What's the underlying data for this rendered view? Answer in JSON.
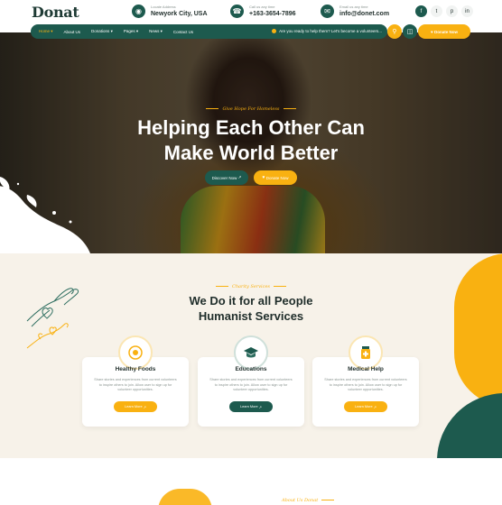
{
  "brand": {
    "name": "Donat"
  },
  "header": {
    "address": {
      "label": "Locate Address",
      "value": "Newyork City, USA"
    },
    "phone": {
      "label": "Call us any time",
      "value": "+163-3654-7896"
    },
    "email": {
      "label": "Email us any time",
      "value": "info@donet.com"
    },
    "social": [
      "f",
      "t",
      "p",
      "in"
    ]
  },
  "nav": {
    "items": [
      "Home",
      "About Us",
      "Donations",
      "Pages",
      "News",
      "Contact Us"
    ],
    "ticker": "Are you ready to help them? Let's become a volunteers...",
    "donate_label": "Donate Now"
  },
  "hero": {
    "kicker": "Give Hope For Homeless",
    "title_line1": "Helping Each Other Can",
    "title_line2": "Make World Better",
    "discover_label": "Discover Now",
    "donate_label": "Donate Now"
  },
  "services": {
    "kicker": "Charity Services",
    "title_line1": "We Do it for all People",
    "title_line2": "Humanist Services",
    "cards": [
      {
        "title": "Healthy Foods",
        "desc": "Share stories and experiences from current volunteers to inspire others to join. Allow user to sign up for volunteer opportunities.",
        "btn": "Learn More",
        "icon": "egg-icon",
        "accent": "#f9b111"
      },
      {
        "title": "Educations",
        "desc": "Share stories and experiences from current volunteers to inspire others to join. Allow user to sign up for volunteer opportunities.",
        "btn": "Learn More",
        "icon": "graduation-cap-icon",
        "accent": "#1d5a4e"
      },
      {
        "title": "Medical Help",
        "desc": "Share stories and experiences from current volunteers to inspire others to join. Allow user to sign up for volunteer opportunities.",
        "btn": "Learn More",
        "icon": "medicine-icon",
        "accent": "#f9b111"
      }
    ]
  },
  "about": {
    "kicker": "About Us Donat"
  },
  "colors": {
    "primary": "#1d5a4e",
    "accent": "#f9b111",
    "cream": "#f7f2e9"
  }
}
